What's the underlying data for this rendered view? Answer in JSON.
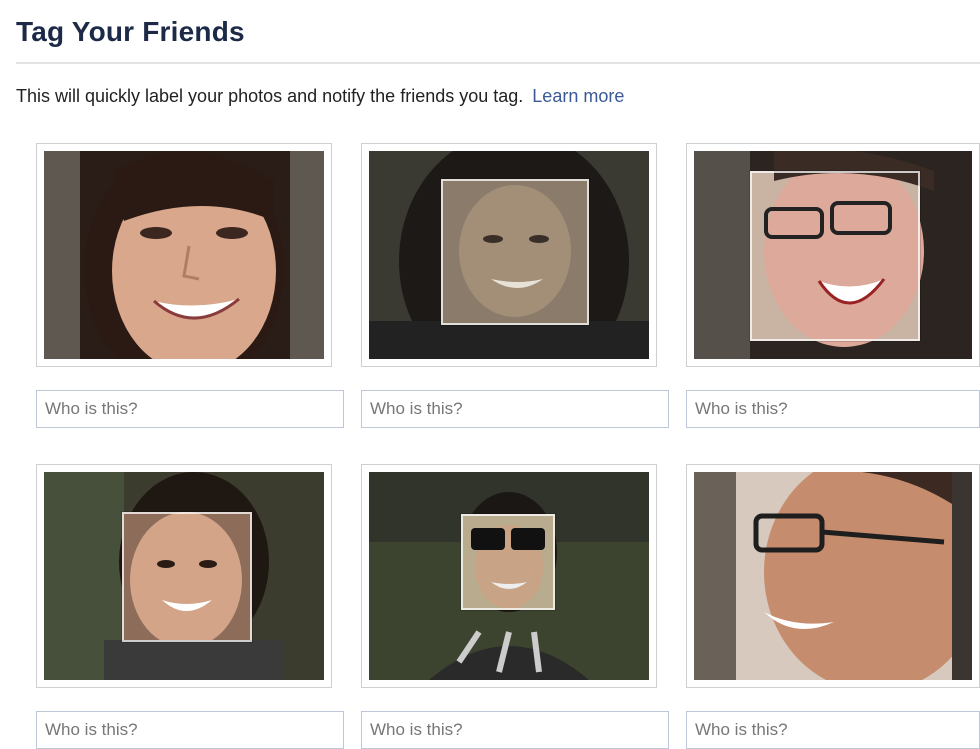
{
  "header": {
    "title": "Tag Your Friends"
  },
  "intro": {
    "text": "This will quickly label your photos and notify the friends you tag.",
    "link": "Learn more"
  },
  "photos": [
    {
      "placeholder": "Who is this?",
      "icon": "person-photo"
    },
    {
      "placeholder": "Who is this?",
      "icon": "person-photo"
    },
    {
      "placeholder": "Who is this?",
      "icon": "person-photo"
    },
    {
      "placeholder": "Who is this?",
      "icon": "person-photo"
    },
    {
      "placeholder": "Who is this?",
      "icon": "person-photo"
    },
    {
      "placeholder": "Who is this?",
      "icon": "person-photo"
    }
  ],
  "colors": {
    "title": "#1c2a47",
    "link": "#3b5998",
    "input_border": "#bdc7d8"
  }
}
